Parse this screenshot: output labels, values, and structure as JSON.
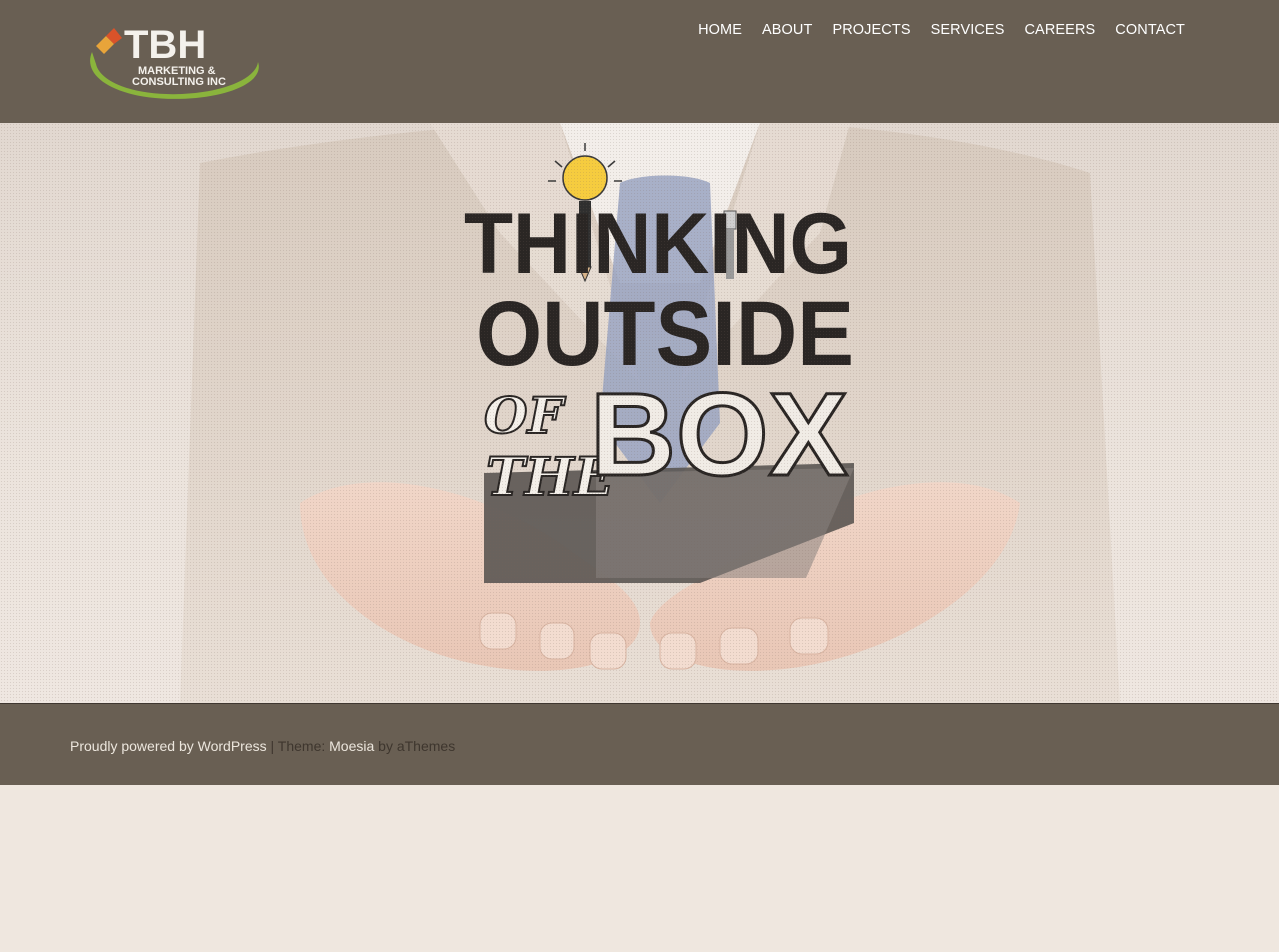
{
  "brand": {
    "logo_title": "TBH",
    "logo_line1": "MARKETING &",
    "logo_line2": "CONSULTING INC",
    "colors": {
      "header_bg": "#695f53",
      "page_bg": "#efe7df",
      "green": "#8ab43c",
      "orange": "#e8a43a",
      "red": "#d9532a"
    }
  },
  "nav": {
    "items": [
      {
        "label": "HOME"
      },
      {
        "label": "ABOUT"
      },
      {
        "label": "PROJECTS"
      },
      {
        "label": "SERVICES"
      },
      {
        "label": "CAREERS"
      },
      {
        "label": "CONTACT"
      }
    ]
  },
  "hero": {
    "line1": "THINKING",
    "line2": "OUTSIDE",
    "line3_script_top": "OF",
    "line3_script_bottom": "THE",
    "line3_box": "BOX",
    "icons": [
      "lightbulb-icon",
      "pencil-icon",
      "usb-plug-icon"
    ]
  },
  "footer": {
    "powered_text": "Proudly powered by WordPress",
    "separator": "|",
    "theme_prefix": "Theme:",
    "theme_name": "Moesia",
    "theme_suffix": "by aThemes"
  }
}
